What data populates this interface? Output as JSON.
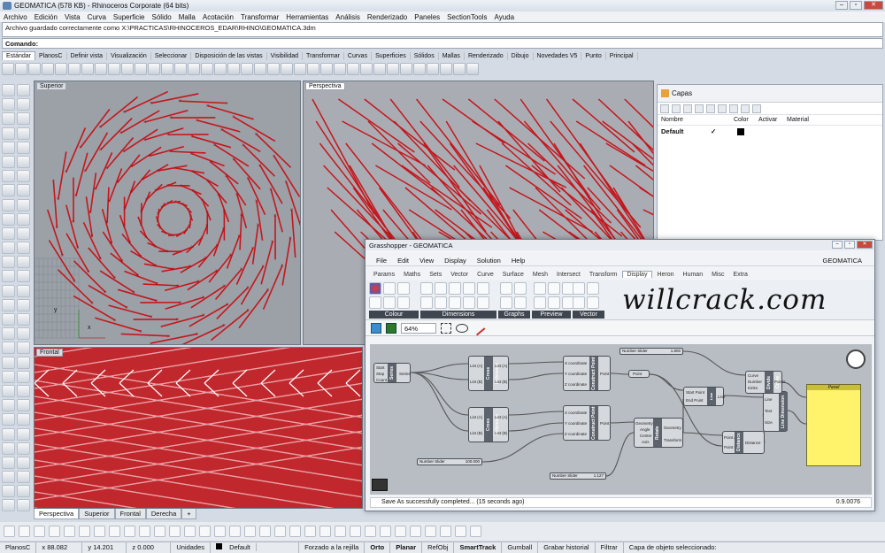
{
  "window": {
    "title": "GEOMATICA (578 KB) - Rhinoceros Corporate (64 bits)"
  },
  "menu": [
    "Archivo",
    "Edición",
    "Vista",
    "Curva",
    "Superficie",
    "Sólido",
    "Malla",
    "Acotación",
    "Transformar",
    "Herramientas",
    "Análisis",
    "Renderizado",
    "Paneles",
    "SectionTools",
    "Ayuda"
  ],
  "command": {
    "history": "Archivo guardado correctamente como X:\\PRACTICAS\\RHINOCEROS_EDAR\\RHINO\\GEOMATICA.3dm",
    "label": "Comando:"
  },
  "toolbar_tabs": [
    "Estándar",
    "PlanosC",
    "Definir vista",
    "Visualización",
    "Seleccionar",
    "Disposición de las vistas",
    "Visibilidad",
    "Transformar",
    "Curvas",
    "Superficies",
    "Sólidos",
    "Mallas",
    "Renderizado",
    "Dibujo",
    "Novedades V5",
    "Punto",
    "Principal"
  ],
  "viewports": {
    "top": "Superior",
    "perspective": "Perspectiva",
    "front": "Frontal",
    "axis_x": "x",
    "axis_y": "y",
    "axis_z": "z"
  },
  "viewport_tabs": [
    "Perspectiva",
    "Superior",
    "Frontal",
    "Derecha"
  ],
  "layers": {
    "title": "Capas",
    "columns": [
      "Nombre",
      "Color",
      "Activar",
      "Material"
    ],
    "rows": [
      {
        "name": "Default",
        "check": "✓"
      }
    ]
  },
  "grasshopper": {
    "title": "Grasshopper - GEOMATICA",
    "document": "GEOMATICA",
    "menu": [
      "File",
      "Edit",
      "View",
      "Display",
      "Solution",
      "Help"
    ],
    "ribbon": [
      "Params",
      "Maths",
      "Sets",
      "Vector",
      "Curve",
      "Surface",
      "Mesh",
      "Intersect",
      "Transform",
      "Display",
      "Heron",
      "Human",
      "Misc",
      "Extra"
    ],
    "active_ribbon": "Display",
    "groups": [
      "Colour",
      "Dimensions",
      "Graphs",
      "Preview",
      "Vector"
    ],
    "watermark": "willcrack.com",
    "zoom": "64%",
    "status": "Save As successfully completed... (15 seconds ago)",
    "version": "0.9.0076",
    "components": {
      "series": {
        "name": "Series",
        "inputs": [
          "Start",
          "Step",
          "Count"
        ],
        "output": "Series"
      },
      "cross1": {
        "name": "Cross Reference",
        "inputs": [
          "List (A)",
          "List (B)"
        ],
        "outputs": [
          "List (A)",
          "List (B)"
        ]
      },
      "cross2": {
        "name": "Cross Reference",
        "inputs": [
          "List (A)",
          "List (B)"
        ],
        "outputs": [
          "List (A)",
          "List (B)"
        ]
      },
      "pt1": {
        "name": "Construct Point",
        "inputs": [
          "X coordinate",
          "Y coordinate",
          "Z coordinate"
        ],
        "output": "Point"
      },
      "pt2": {
        "name": "Construct Point",
        "inputs": [
          "X coordinate",
          "Y coordinate",
          "Z coordinate"
        ],
        "output": "Point"
      },
      "point": "Point",
      "rotate": {
        "name": "Rotate",
        "inputs": [
          "Geometry",
          "Angle",
          "Center",
          "Axis"
        ],
        "outputs": [
          "Geometry",
          "Transform"
        ]
      },
      "line": {
        "name": "Line",
        "inputs": [
          "Start Point",
          "End Point"
        ],
        "output": "Line"
      },
      "dist": {
        "name": "Distance",
        "inputs": [
          "Point A",
          "Point B"
        ],
        "output": "Distance"
      },
      "linedim": {
        "name": "Line Dimension",
        "inputs": [
          "Line",
          "Text",
          "Size"
        ]
      },
      "divide": {
        "name": "Divide Curve",
        "inputs": [
          "Curve",
          "Number",
          "Kinks"
        ],
        "output": "Points"
      }
    },
    "sliders": [
      {
        "label": "Number Slider",
        "value": "1.800"
      },
      {
        "label": "Number Slider",
        "value": "100.000"
      },
      {
        "label": "Number Slider",
        "value": "1.127"
      }
    ],
    "panel": {
      "title": "Panel"
    }
  },
  "statusbar": {
    "plane": "PlanosC",
    "x": "x 88.082",
    "y": "y 14.201",
    "z": "z 0.000",
    "units": "Unidades",
    "layer": "Default",
    "snap": "Forzado a la rejilla",
    "ortho": "Orto",
    "planar": "Planar",
    "osnap": "RefObj",
    "smarttrack": "SmartTrack",
    "gumball": "Gumball",
    "history": "Grabar historial",
    "filter": "Filtrar",
    "object_layer": "Capa de objeto seleccionado:"
  },
  "colors": {
    "curves": "#c4161c",
    "panel": "#fff36b",
    "viewport_bg": "#9ca1a8"
  }
}
